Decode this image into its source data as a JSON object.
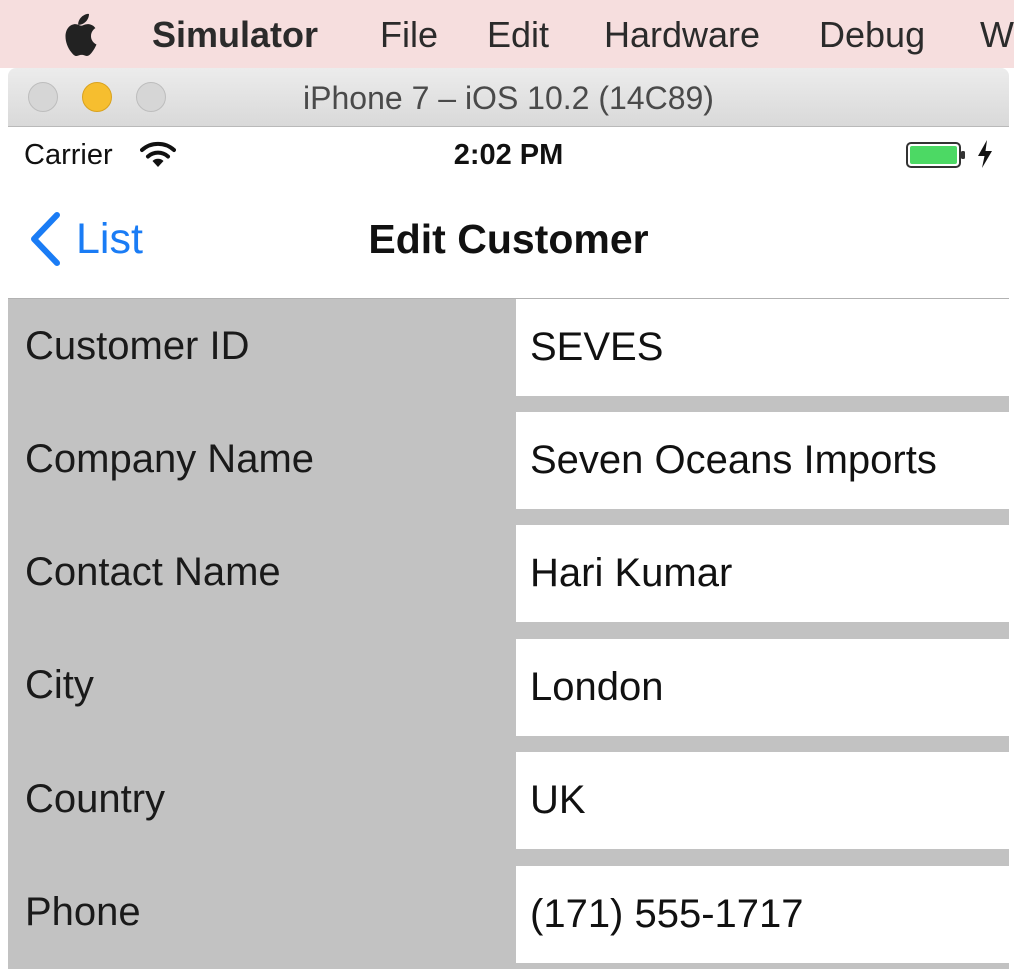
{
  "menubar": {
    "apple_icon": "apple-icon",
    "items": [
      "Simulator",
      "File",
      "Edit",
      "Hardware",
      "Debug",
      "W"
    ]
  },
  "window": {
    "title": "iPhone 7 – iOS 10.2 (14C89)",
    "traffic_lights": [
      "close",
      "minimize",
      "zoom"
    ]
  },
  "status_bar": {
    "carrier": "Carrier",
    "time": "2:02 PM",
    "wifi_icon": "wifi-icon",
    "battery_icon": "battery-icon",
    "battery_level": 1.0,
    "charging_icon": "charging-bolt-icon"
  },
  "nav": {
    "back_label": "List",
    "title": "Edit Customer"
  },
  "form": {
    "fields": [
      {
        "label": "Customer ID",
        "value": "SEVES"
      },
      {
        "label": "Company Name",
        "value": "Seven Oceans Imports"
      },
      {
        "label": "Contact Name",
        "value": "Hari Kumar"
      },
      {
        "label": "City",
        "value": "London"
      },
      {
        "label": "Country",
        "value": "UK"
      },
      {
        "label": "Phone",
        "value": "(171) 555-1717"
      }
    ]
  },
  "colors": {
    "menubar_bg": "#f6dede",
    "ios_blue": "#1a7cf5",
    "form_bg": "#c2c2c2",
    "battery_green": "#4cd964",
    "minimize_yellow": "#f6be2f"
  }
}
